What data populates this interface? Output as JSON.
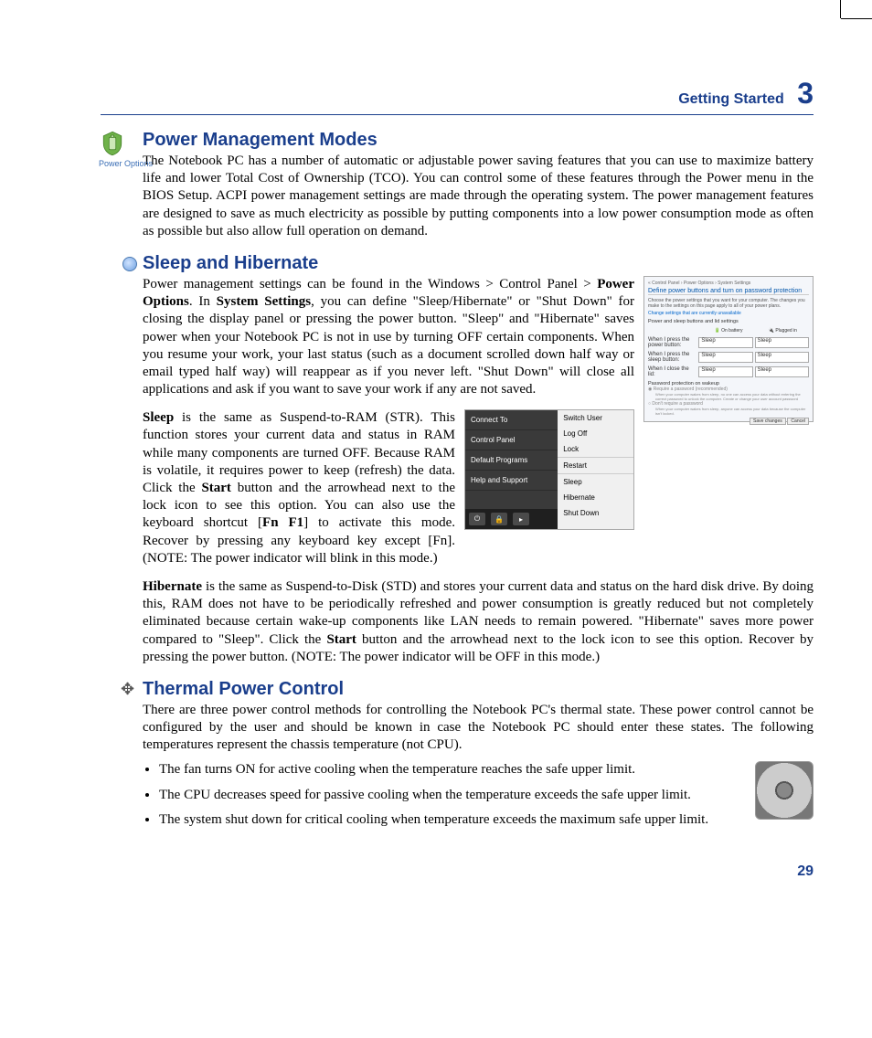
{
  "header": {
    "chapter_title": "Getting Started",
    "chapter_number": "3"
  },
  "section_power_mgmt": {
    "icon_caption": "Power Options",
    "heading": "Power Management Modes",
    "body": "The Notebook PC has a number of automatic or adjustable power saving features that you can use to maximize battery life and lower Total Cost of Ownership (TCO). You can control some of these features through the Power menu in the BIOS Setup. ACPI power management settings are made through the operating system. The power management features are designed to save as much electricity as possible by putting components into a low power consumption mode as often as possible but also allow full operation on demand."
  },
  "section_sleep": {
    "heading": "Sleep and Hibernate",
    "para1_pre": "Power management settings can be found in the Windows > Control Panel > ",
    "para1_b1": "Power Options",
    "para1_mid1": ". In ",
    "para1_b2": "System Settings",
    "para1_post": ", you can define \"Sleep/Hibernate\" or \"Shut Down\" for closing the display panel or pressing the power button. \"Sleep\" and \"Hibernate\" saves power when your Notebook PC is not in use by turning OFF certain components. When you resume your work, your last status (such as a document scrolled down half way or email typed half way) will reappear as if you never left. \"Shut Down\" will close all applications and ask if you want to save your work if any are not saved.",
    "para2_b1": "Sleep",
    "para2_mid1": " is the same as Suspend-to-RAM (STR). This function stores your current data and status in RAM while many components are turned OFF. Because RAM is volatile, it requires power to keep (refresh) the data. Click the ",
    "para2_b2": "Start",
    "para2_mid2": " button and the arrowhead next to the lock icon to see this option. You can also use the keyboard shortcut [",
    "para2_b3": "Fn F1",
    "para2_post": "] to activate this mode. Recover by pressing any keyboard key except [Fn]. (NOTE: The power indicator will blink in this mode.)",
    "para3_b1": "Hibernate",
    "para3_mid1": " is the same as  Suspend-to-Disk (STD) and stores your current data and status on the hard disk drive. By doing this, RAM does not have to be periodically refreshed and power consumption is greatly reduced but not completely eliminated because certain wake-up components like LAN needs to remain powered. \"Hibernate\" saves more power compared to \"Sleep\". Click the ",
    "para3_b2": "Start",
    "para3_post": " button and the arrowhead next to the lock icon to see this option. Recover by pressing the power button. (NOTE: The power indicator will be OFF in this mode.)"
  },
  "power_options_mock": {
    "breadcrumb": "« Control Panel › Power Options › System Settings",
    "title": "Define power buttons and turn on password protection",
    "subtitle": "Choose the power settings that you want for your computer. The changes you make to the settings on this page apply to all of your power plans.",
    "link": "Change settings that are currently unavailable",
    "section": "Power and sleep buttons and lid settings",
    "col_battery": "On battery",
    "col_plugged": "Plugged in",
    "row1": "When I press the power button:",
    "row2": "When I press the sleep button:",
    "row3": "When I close the lid:",
    "val_sleep": "Sleep",
    "pw_section": "Password protection on wakeup",
    "opt1": "Require a password (recommended)",
    "opt1_desc": "When your computer wakes from sleep, no one can access your data without entering the correct password to unlock the computer. Create or change your user account password",
    "opt2": "Don't require a password",
    "opt2_desc": "When your computer wakes from sleep, anyone can access your data because the computer isn't locked.",
    "btn_save": "Save changes",
    "btn_cancel": "Cancel"
  },
  "start_menu_mock": {
    "left": [
      "Connect To",
      "Control Panel",
      "Default Programs",
      "Help and Support"
    ],
    "right": [
      "Switch User",
      "Log Off",
      "Lock",
      "Restart",
      "Sleep",
      "Hibernate",
      "Shut Down"
    ],
    "power_glyph": "⏻",
    "lock_glyph": "🔒",
    "arrow_glyph": "▸"
  },
  "section_thermal": {
    "heading": "Thermal Power Control",
    "body": "There are three power control methods for controlling the Notebook PC's thermal state. These power control cannot be configured by the user and should be known in case the Notebook PC should enter these states. The following temperatures represent the chassis temperature (not CPU).",
    "bullets": [
      "The fan turns ON for active cooling when the temperature reaches the safe upper limit.",
      "The CPU decreases speed for passive cooling when the temperature exceeds the safe upper limit.",
      "The system shut down for critical cooling when temperature exceeds the maximum safe upper limit."
    ]
  },
  "page_number": "29"
}
